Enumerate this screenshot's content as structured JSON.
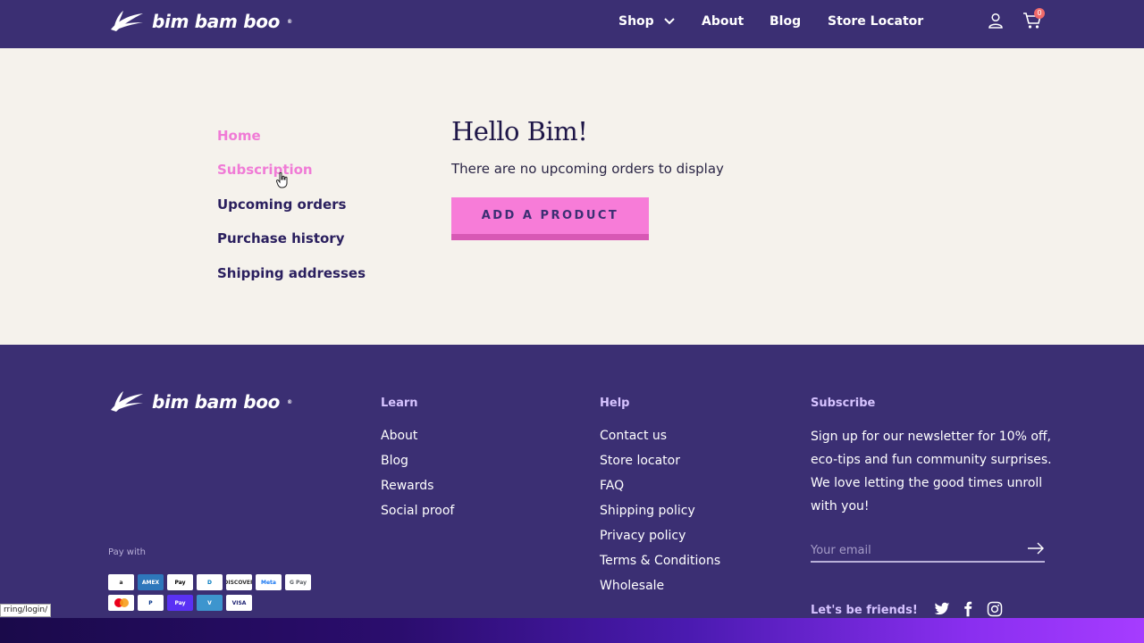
{
  "header": {
    "brand": "bim bam boo",
    "nav": [
      {
        "label": "Shop"
      },
      {
        "label": "About"
      },
      {
        "label": "Blog"
      },
      {
        "label": "Store Locator"
      }
    ],
    "cart_count": "0"
  },
  "sidebar": {
    "items": [
      {
        "label": "Home"
      },
      {
        "label": "Subscription"
      },
      {
        "label": "Upcoming orders"
      },
      {
        "label": "Purchase history"
      },
      {
        "label": "Shipping addresses"
      }
    ]
  },
  "main": {
    "greeting": "Hello Bim!",
    "empty_message": "There are no upcoming orders to display",
    "add_button": "ADD A PRODUCT"
  },
  "footer": {
    "brand": "bim bam boo",
    "learn": {
      "title": "Learn",
      "links": [
        "About",
        "Blog",
        "Rewards",
        "Social proof"
      ]
    },
    "help": {
      "title": "Help",
      "links": [
        "Contact us",
        "Store locator",
        "FAQ",
        "Shipping policy",
        "Privacy policy",
        "Terms & Conditions",
        "Wholesale"
      ]
    },
    "subscribe": {
      "title": "Subscribe",
      "text": "Sign up for our newsletter for 10% off, eco-tips and fun community surprises. We love letting the good times unroll with you!",
      "email_placeholder": "Your email",
      "friends": "Let's be friends!"
    },
    "pay_with": "Pay with",
    "payments": [
      {
        "name": "amazon-pay-icon",
        "text": "a",
        "bg": "#ffffff",
        "fg": "#222222"
      },
      {
        "name": "amex-icon",
        "text": "AMEX",
        "bg": "#2e77bb",
        "fg": "#ffffff"
      },
      {
        "name": "apple-pay-icon",
        "text": "Pay",
        "bg": "#ffffff",
        "fg": "#000000"
      },
      {
        "name": "diners-club-icon",
        "text": "D",
        "bg": "#ffffff",
        "fg": "#0079be"
      },
      {
        "name": "discover-icon",
        "text": "DISCOVER",
        "bg": "#ffffff",
        "fg": "#333333"
      },
      {
        "name": "meta-pay-icon",
        "text": "Meta",
        "bg": "#ffffff",
        "fg": "#1877f2"
      },
      {
        "name": "google-pay-icon",
        "text": "G Pay",
        "bg": "#ffffff",
        "fg": "#5f6368"
      },
      {
        "name": "mastercard-icon",
        "text": "",
        "bg": "#ffffff",
        "fg": "#eb001b"
      },
      {
        "name": "paypal-icon",
        "text": "P",
        "bg": "#ffffff",
        "fg": "#003087"
      },
      {
        "name": "shop-pay-icon",
        "text": "Pay",
        "bg": "#5a31f4",
        "fg": "#ffffff"
      },
      {
        "name": "venmo-icon",
        "text": "V",
        "bg": "#3d95ce",
        "fg": "#ffffff"
      },
      {
        "name": "visa-icon",
        "text": "VISA",
        "bg": "#ffffff",
        "fg": "#1a1f71"
      }
    ]
  },
  "status_url": "rring/login/",
  "colors": {
    "brand_purple": "#3b2f73",
    "pink": "#f77cd8",
    "pink_text": "#f07bd6",
    "cream": "#f5f2ec",
    "lavender": "#d6c3ff"
  }
}
